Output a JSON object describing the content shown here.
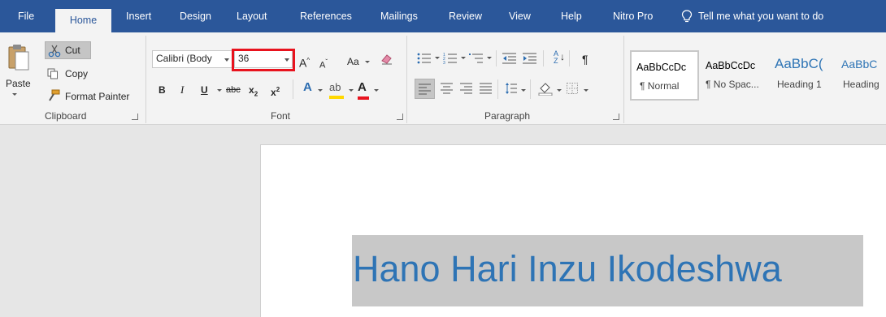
{
  "tabs": [
    {
      "label": "File"
    },
    {
      "label": "Home"
    },
    {
      "label": "Insert"
    },
    {
      "label": "Design"
    },
    {
      "label": "Layout"
    },
    {
      "label": "References"
    },
    {
      "label": "Mailings"
    },
    {
      "label": "Review"
    },
    {
      "label": "View"
    },
    {
      "label": "Help"
    },
    {
      "label": "Nitro Pro"
    }
  ],
  "active_tab": "Home",
  "tell_me": {
    "label": "Tell me what you want to do",
    "icon": "lightbulb-icon"
  },
  "clipboard": {
    "paste_label": "Paste",
    "cut_label": "Cut",
    "copy_label": "Copy",
    "format_painter_label": "Format Painter",
    "group_label": "Clipboard"
  },
  "font": {
    "font_name": "Calibri (Body",
    "font_size": "36",
    "case_label": "Aa",
    "bold": "B",
    "italic": "I",
    "underline": "U",
    "strike": "abc",
    "subscript": "x",
    "superscript": "x",
    "group_label": "Font",
    "highlight_color": "#ffd800",
    "font_color": "#e8131e",
    "size_highlight_color": "#e8131e"
  },
  "paragraph": {
    "group_label": "Paragraph",
    "pilcrow": "¶",
    "sort": "A Z"
  },
  "styles": [
    {
      "preview": "AaBbCcDc",
      "name": "¶ Normal"
    },
    {
      "preview": "AaBbCcDc",
      "name": "¶ No Spac..."
    },
    {
      "preview": "AaBbC(",
      "name": "Heading 1"
    },
    {
      "preview": "AaBbC",
      "name": "Heading"
    }
  ],
  "document": {
    "selected_text": "Hano Hari Inzu Ikodeshwa",
    "text_color": "#2e74b5"
  },
  "colors": {
    "title_bar": "#2b579a",
    "ribbon": "#f3f3f3",
    "canvas": "#e6e6e6"
  }
}
